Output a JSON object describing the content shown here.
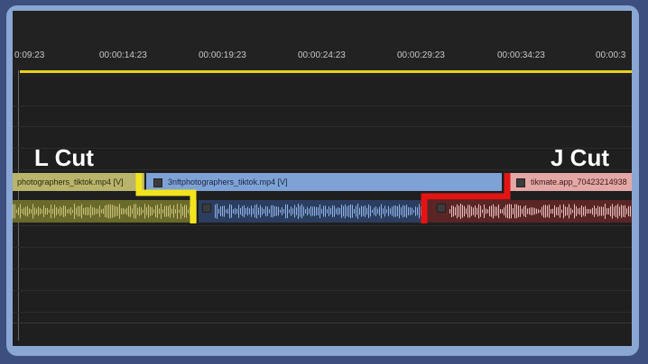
{
  "timeline": {
    "timecodes": [
      "0:09:23",
      "00:00:14:23",
      "00:00:19:23",
      "00:00:24:23",
      "00:00:29:23",
      "00:00:34:23",
      "00:00:3"
    ]
  },
  "labels": {
    "l_cut": "L Cut",
    "j_cut": "J Cut"
  },
  "clips": {
    "left": "photographers_tiktok.mp4 [V]",
    "middle": "3nftphotographers_tiktok.mp4 [V]",
    "right": "tikmate.app_70423214938"
  },
  "colors": {
    "l_cut_marker": "#f2e41c",
    "j_cut_marker": "#e41414",
    "playhead": "#e6d21f",
    "left_clip": "#b9b46b",
    "middle_clip": "#7ea2d6",
    "right_clip": "#e3a8a5"
  },
  "icons": {
    "clip_icon": "film-icon"
  }
}
